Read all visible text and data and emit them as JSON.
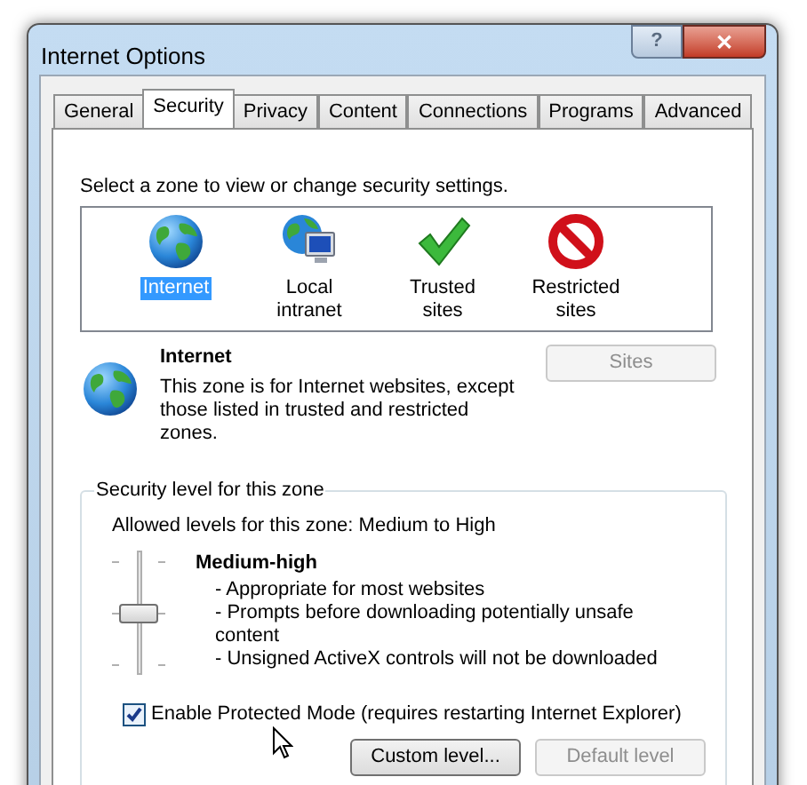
{
  "window": {
    "title": "Internet Options",
    "buttons": [
      "?",
      "✕"
    ]
  },
  "tabs": [
    {
      "label": "General",
      "selected": false
    },
    {
      "label": "Security",
      "selected": true
    },
    {
      "label": "Privacy",
      "selected": false
    },
    {
      "label": "Content",
      "selected": false
    },
    {
      "label": "Connections",
      "selected": false
    },
    {
      "label": "Programs",
      "selected": false
    },
    {
      "label": "Advanced",
      "selected": false
    }
  ],
  "zone_prompt": "Select a zone to view or change security settings.",
  "zones": [
    {
      "label": "Internet",
      "kind": "globe",
      "selected": true
    },
    {
      "label": "Local intranet",
      "kind": "intranet",
      "selected": false
    },
    {
      "label": "Trusted sites",
      "kind": "check",
      "selected": false
    },
    {
      "label": "Restricted sites",
      "kind": "blocked",
      "selected": false
    }
  ],
  "zone_info": {
    "kind": "globe",
    "name": "Internet",
    "description": "This zone is for Internet websites, except those listed in trusted and restricted zones.",
    "sites_button": {
      "label": "Sites",
      "disabled": true
    }
  },
  "security_level": {
    "legend": "Security level for this zone",
    "allowed": "Allowed levels for this zone: Medium to High",
    "level": 0.5,
    "level_name": "Medium-high",
    "details": [
      "- Appropriate for most websites",
      "- Prompts before downloading potentially unsafe content",
      "- Unsigned ActiveX controls will not be downloaded"
    ],
    "protected_mode": {
      "label": "Enable Protected Mode (requires restarting Internet Explorer)",
      "checked": true
    },
    "buttons": [
      {
        "label": "Custom level...",
        "disabled": false
      },
      {
        "label": "Default level",
        "disabled": true
      }
    ]
  }
}
